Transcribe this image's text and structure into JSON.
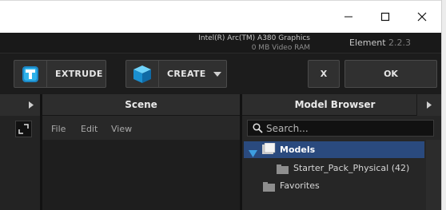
{
  "window": {
    "minimize_icon": "minimize-icon",
    "maximize_icon": "maximize-icon",
    "close_icon": "close-icon"
  },
  "info": {
    "gpu_name": "Intel(R) Arc(TM) A380 Graphics",
    "video_ram": "0 MB Video RAM",
    "plugin_name": "Element",
    "version": "2.2.3"
  },
  "toolbar": {
    "extrude_label": "EXTRUDE",
    "create_label": "CREATE",
    "cancel_label": "X",
    "ok_label": "OK"
  },
  "panels": {
    "scene_title": "Scene",
    "model_browser_title": "Model Browser"
  },
  "scene_menu": [
    "File",
    "Edit",
    "View"
  ],
  "browser": {
    "search_placeholder": "Search...",
    "tree": [
      {
        "label": "Models",
        "expanded": true,
        "selected": true
      },
      {
        "label": "Starter_Pack_Physical (42)"
      },
      {
        "label": "Favorites"
      }
    ]
  },
  "colors": {
    "accent": "#29a3d9",
    "selection": "#2a4a7e",
    "background": "#191919"
  }
}
